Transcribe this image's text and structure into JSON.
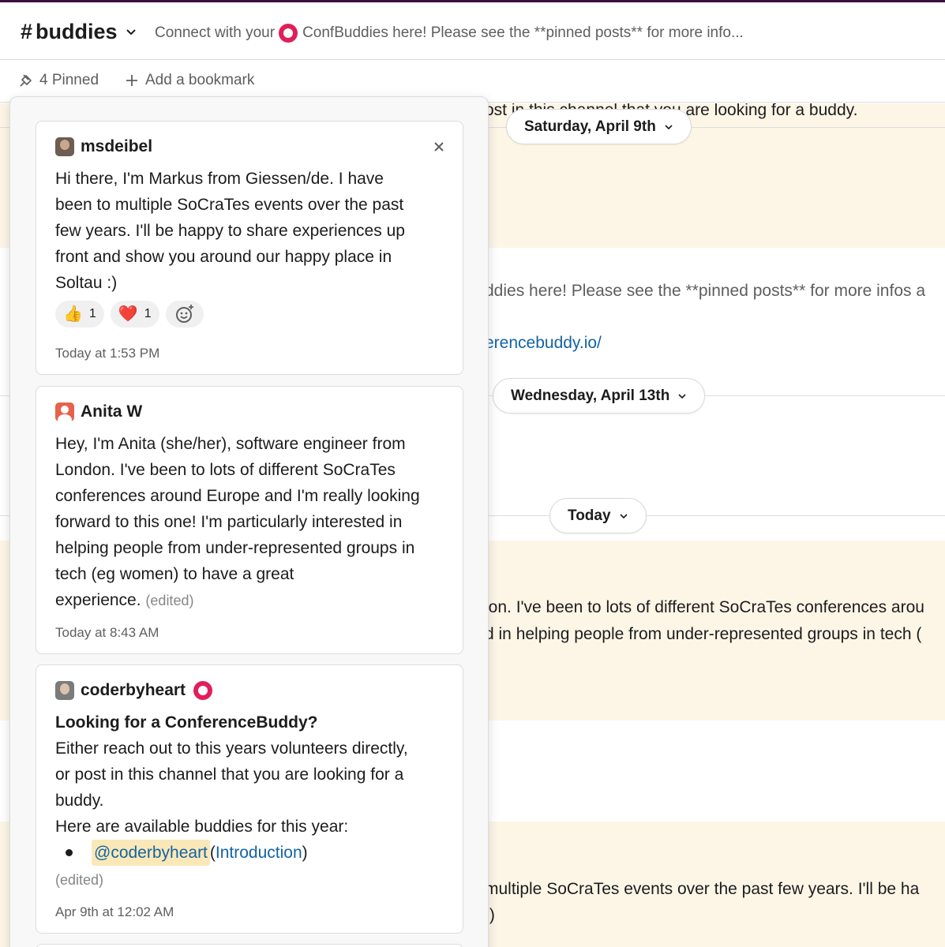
{
  "header": {
    "channel_hash": "#",
    "channel_name": "buddies",
    "topic_before": "Connect with your",
    "topic_after": "ConfBuddies here! Please see the **pinned posts** for more info..."
  },
  "bookmarks": {
    "pinned_label": "4 Pinned",
    "add_label": "Add a bookmark"
  },
  "background": {
    "line1": "ost in this channel that you are looking for a buddy.",
    "date1": "Saturday, April 9th",
    "line2": "ddies here! Please see the **pinned posts** for more infos a",
    "line3": "erencebuddy.io/",
    "date2": "Wednesday, April 13th",
    "date3": "Today",
    "line4": "lon. I've been to lots of different SoCraTes conferences arou",
    "line5": "d in helping people from under-represented groups in tech (",
    "line6": "multiple SoCraTes events over the past few years. I'll be ha",
    "line7": ":)"
  },
  "pins": [
    {
      "author": "msdeibel",
      "body_lines": [
        "Hi there, I'm Markus from Giessen/de. I have",
        "been to multiple SoCraTes events over the past",
        "few years. I'll be happy to share experiences up",
        "front and show you around our happy place in",
        "Soltau :)"
      ],
      "reactions": [
        {
          "emoji": "👍",
          "count": "1"
        },
        {
          "emoji": "❤️",
          "count": "1"
        }
      ],
      "timestamp": "Today at 1:53 PM"
    },
    {
      "author": "Anita W",
      "body_lines": [
        "Hey, I'm Anita (she/her), software engineer from",
        "London. I've been to lots of different SoCraTes",
        "conferences around Europe and I'm really looking",
        "forward to this one! I'm particularly interested in",
        "helping people from under-represented groups in",
        "tech (eg women) to have a great",
        "experience."
      ],
      "edited": "(edited)",
      "timestamp": "Today at 8:43 AM"
    },
    {
      "author": "coderbyheart",
      "title": "Looking for a ConferenceBuddy?",
      "body_lines": [
        "Either reach out to this years volunteers directly,",
        "or post in this channel that you are looking for a",
        "buddy.",
        "Here are available buddies for this year:"
      ],
      "mention": "@coderbyheart",
      "paren_open": " (",
      "intro_link": "Introduction",
      "paren_close": ")",
      "edited": "(edited)",
      "timestamp": "Apr 9th at 12:02 AM"
    }
  ],
  "colors": {
    "aubergine": "#3f0e40",
    "highlight_band": "#fdf6e7",
    "link": "#1264a3",
    "mention_bg": "#fbe8b8"
  }
}
